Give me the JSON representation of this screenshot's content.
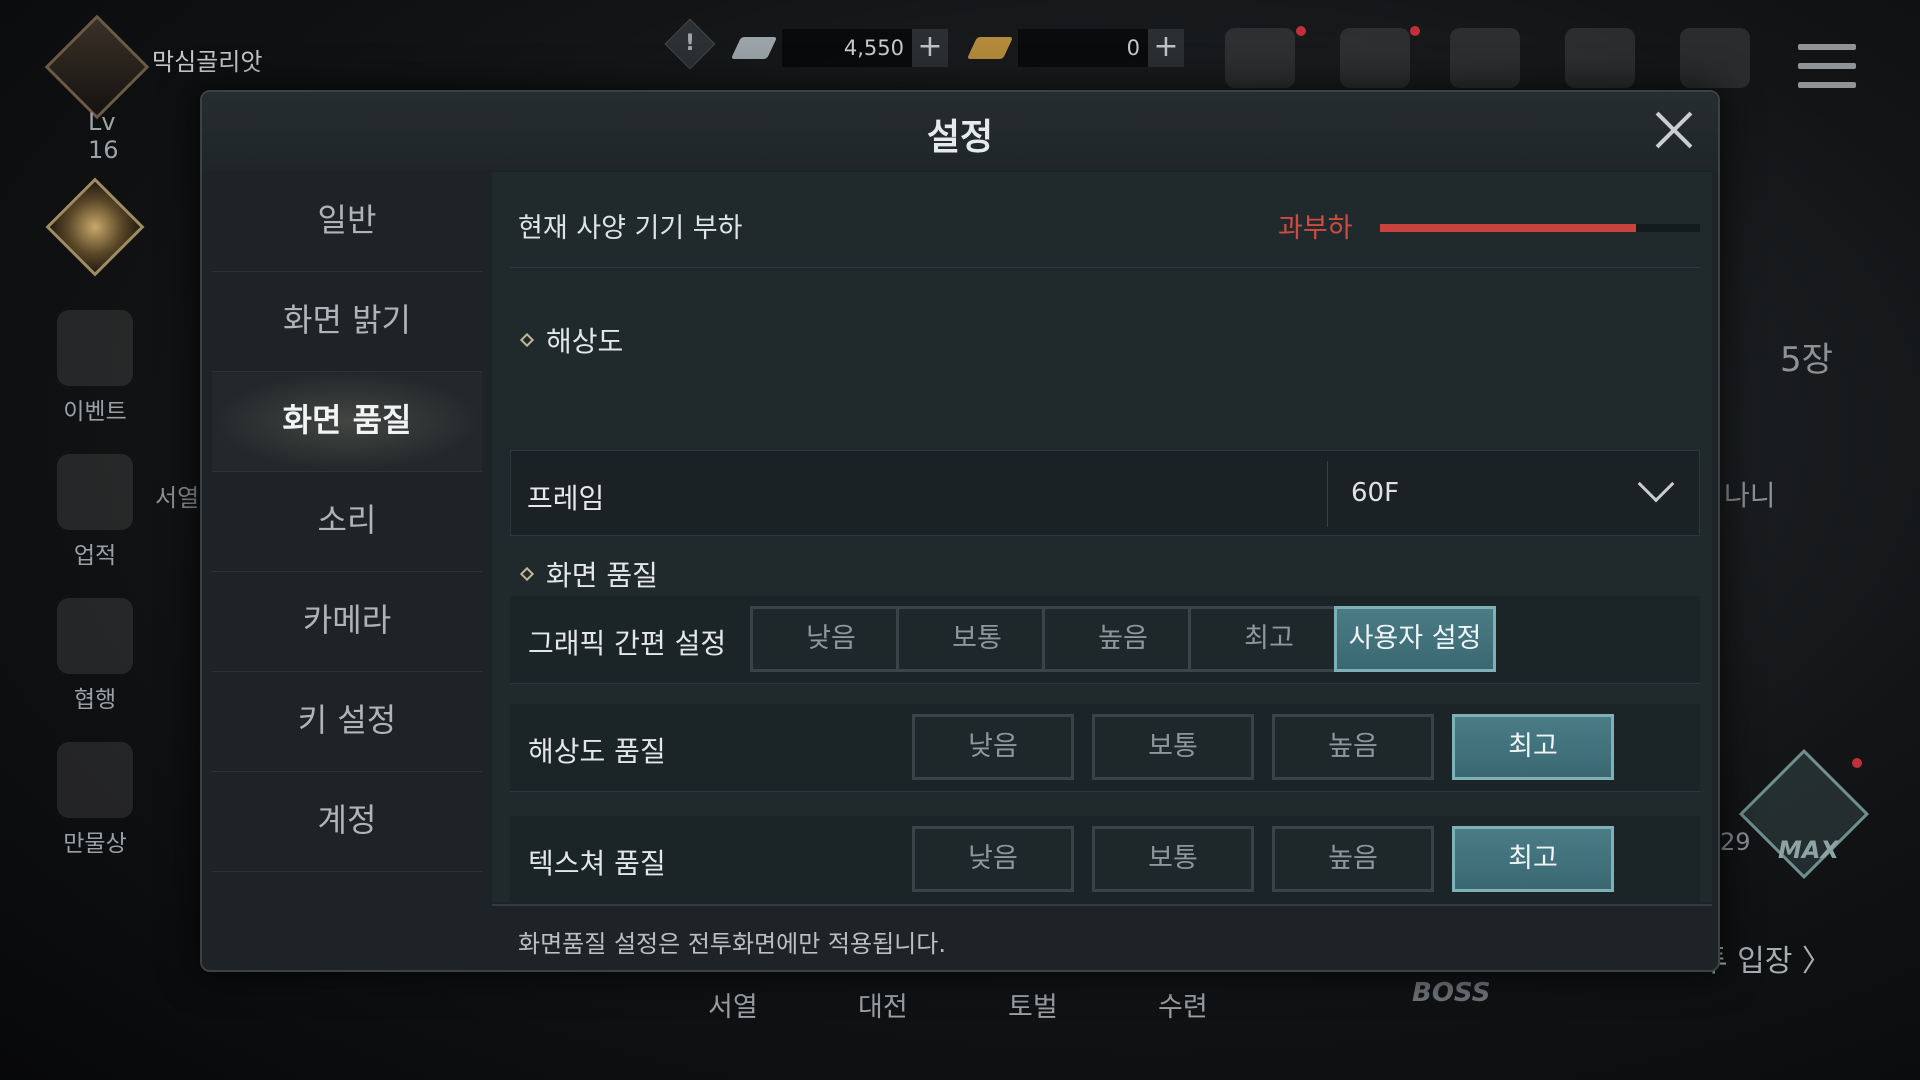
{
  "profile": {
    "name": "막심골리앗",
    "level": "Lv 16"
  },
  "currency": [
    {
      "amount": "4,550",
      "plus": "+",
      "color": "#9aa4a8"
    },
    {
      "amount": "0",
      "plus": "+",
      "color": "#b38a3a"
    }
  ],
  "alert": "!",
  "sidebar_left": {
    "items": [
      {
        "label": "이벤트"
      },
      {
        "label": "업적"
      },
      {
        "label": "협행"
      },
      {
        "label": "만물상"
      }
    ]
  },
  "background_text": {
    "seoyeol_side": "서열",
    "count": "5장",
    "nani": "나니",
    "num29": "29",
    "enter": "투 입장 〉",
    "boss": "BOSS",
    "max": "MAX",
    "bottom_tabs": [
      "서열",
      "대전",
      "토벌",
      "수련"
    ]
  },
  "modal": {
    "title": "설정",
    "nav": [
      {
        "label": "일반"
      },
      {
        "label": "화면 밝기"
      },
      {
        "label": "화면 품질"
      },
      {
        "label": "소리"
      },
      {
        "label": "카메라"
      },
      {
        "label": "키 설정"
      },
      {
        "label": "계정"
      }
    ],
    "active_nav": "화면 품질",
    "device_load": {
      "label": "현재 사양 기기 부하",
      "status": "과부하",
      "level": 0.8
    },
    "resolution_section": {
      "title": "해상도"
    },
    "frame": {
      "label": "프레임",
      "value": "60F"
    },
    "quality_section": {
      "title": "화면 품질"
    },
    "quality_rows": [
      {
        "label": "그래픽 간편 설정",
        "options": [
          "낮음",
          "보통",
          "높음",
          "최고",
          "사용자 설정"
        ],
        "selected": "사용자 설정"
      },
      {
        "label": "해상도 품질",
        "options": [
          "낮음",
          "보통",
          "높음",
          "최고"
        ],
        "selected": "최고"
      },
      {
        "label": "텍스쳐 품질",
        "options": [
          "낮음",
          "보통",
          "높음",
          "최고"
        ],
        "selected": "최고"
      }
    ],
    "footer_note": "화면품질 설정은 전투화면에만 적용됩니다."
  },
  "colors": {
    "accent_selected": "#4a7c86",
    "overload": "#cf4b41"
  }
}
